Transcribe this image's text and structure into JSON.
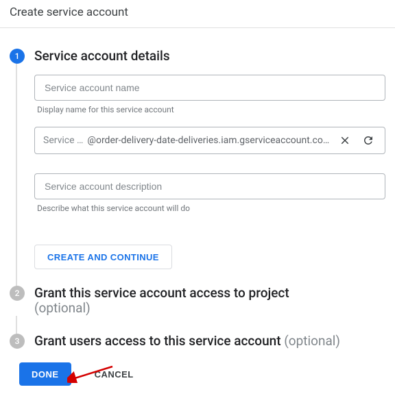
{
  "page": {
    "title": "Create service account"
  },
  "steps": {
    "details": {
      "number": "1",
      "title": "Service account details",
      "name_placeholder": "Service account name",
      "name_helper": "Display name for this service account",
      "id_prefix": "Service …",
      "id_suffix": "@order-delivery-date-deliveries.iam.gserviceaccount.com",
      "desc_placeholder": "Service account description",
      "desc_helper": "Describe what this service account will do",
      "create_btn": "CREATE AND CONTINUE"
    },
    "grant_project": {
      "number": "2",
      "title": "Grant this service account access to project",
      "optional": "(optional)"
    },
    "grant_users": {
      "number": "3",
      "title": "Grant users access to this service account ",
      "optional": "(optional)"
    }
  },
  "footer": {
    "done": "DONE",
    "cancel": "CANCEL"
  },
  "icons": {
    "clear": "close-icon",
    "refresh": "refresh-icon"
  }
}
